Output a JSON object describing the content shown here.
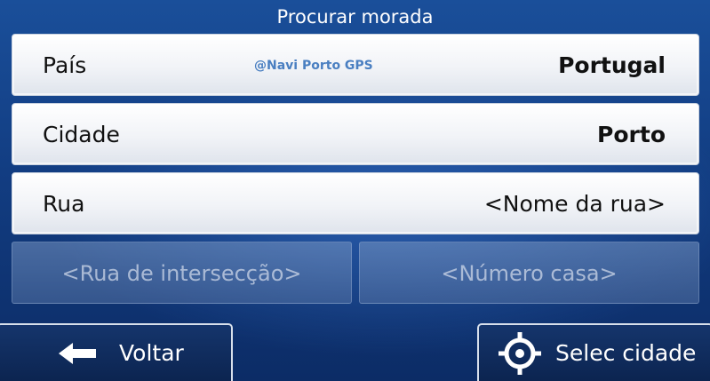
{
  "header": {
    "title": "Procurar morada"
  },
  "watermark": "@Navi Porto GPS",
  "fields": {
    "country": {
      "label": "País",
      "value": "Portugal"
    },
    "city": {
      "label": "Cidade",
      "value": "Porto"
    },
    "street": {
      "label": "Rua",
      "value": "<Nome da rua>"
    }
  },
  "disabled_fields": {
    "intersection": "<Rua de intersecção>",
    "house_number": "<Número casa>"
  },
  "footer": {
    "back": {
      "label": "Voltar",
      "icon": "arrow-left-icon"
    },
    "select_city": {
      "label": "Selec cidade",
      "icon": "crosshair-icon"
    }
  },
  "colors": {
    "background": "#123d82",
    "field_background": "#f1f3f7",
    "disabled_background": "#5573a5",
    "button_background": "#0b234e"
  }
}
